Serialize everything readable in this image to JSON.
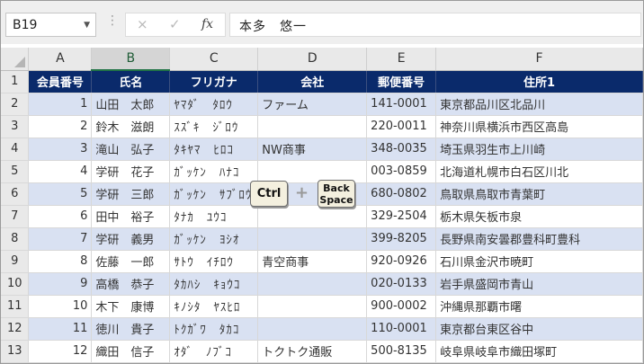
{
  "name_box": {
    "value": "B19"
  },
  "formula_bar": {
    "dots": "⋮",
    "cancel_icon": "×",
    "enter_icon": "✓",
    "fx_label": "fx",
    "content": "本多　悠一"
  },
  "columns": [
    "A",
    "B",
    "C",
    "D",
    "E",
    "F"
  ],
  "selected_column": "B",
  "header_row": {
    "row_number": "1",
    "cells": [
      "会員番号",
      "氏名",
      "フリガナ",
      "会社",
      "郵便番号",
      "住所1"
    ]
  },
  "rows": [
    {
      "row": "2",
      "id": "1",
      "name": "山田　太郎",
      "kana": "ﾔﾏﾀﾞ　ﾀﾛｳ",
      "company": "ファーム",
      "zip": "141-0001",
      "address": "東京都品川区北品川"
    },
    {
      "row": "3",
      "id": "2",
      "name": "鈴木　滋朗",
      "kana": "ｽｽﾞｷ　ｼﾞﾛｳ",
      "company": "",
      "zip": "220-0011",
      "address": "神奈川県横浜市西区高島"
    },
    {
      "row": "4",
      "id": "3",
      "name": "滝山　弘子",
      "kana": "ﾀｷﾔﾏ　ﾋﾛｺ",
      "company": "NW商事",
      "zip": "348-0035",
      "address": "埼玉県羽生市上川崎"
    },
    {
      "row": "5",
      "id": "4",
      "name": "学研　花子",
      "kana": "ｶﾞｯｹﾝ　ﾊﾅｺ",
      "company": "",
      "zip": "003-0859",
      "address": "北海道札幌市白石区川北"
    },
    {
      "row": "6",
      "id": "5",
      "name": "学研　三郎",
      "kana": "ｶﾞｯｹﾝ　ｻﾌﾞﾛｳ",
      "company": "",
      "zip": "680-0802",
      "address": "鳥取県鳥取市青葉町"
    },
    {
      "row": "7",
      "id": "6",
      "name": "田中　裕子",
      "kana": "ﾀﾅｶ　ﾕｳｺ",
      "company": "",
      "zip": "329-2504",
      "address": "栃木県矢板市泉"
    },
    {
      "row": "8",
      "id": "7",
      "name": "学研　義男",
      "kana": "ｶﾞｯｹﾝ　ﾖｼｵ",
      "company": "",
      "zip": "399-8205",
      "address": "長野県南安曇郡豊科町豊科"
    },
    {
      "row": "9",
      "id": "8",
      "name": "佐藤　一郎",
      "kana": "ｻﾄｳ　ｲﾁﾛｳ",
      "company": "青空商事",
      "zip": "920-0926",
      "address": "石川県金沢市暁町"
    },
    {
      "row": "10",
      "id": "9",
      "name": "高橋　恭子",
      "kana": "ﾀｶﾊｼ　ｷｮｳｺ",
      "company": "",
      "zip": "020-0133",
      "address": "岩手県盛岡市青山"
    },
    {
      "row": "11",
      "id": "10",
      "name": "木下　康博",
      "kana": "ｷﾉｼﾀ　ﾔｽﾋﾛ",
      "company": "",
      "zip": "900-0002",
      "address": "沖縄県那覇市曙"
    },
    {
      "row": "12",
      "id": "11",
      "name": "徳川　貴子",
      "kana": "ﾄｸｶﾞﾜ　ﾀｶｺ",
      "company": "",
      "zip": "110-0001",
      "address": "東京都台東区谷中"
    },
    {
      "row": "13",
      "id": "12",
      "name": "織田　信子",
      "kana": "ｵﾀﾞ　ﾉﾌﾞｺ",
      "company": "トクトク通販",
      "zip": "500-8135",
      "address": "岐阜県岐阜市織田塚町"
    }
  ],
  "keys": {
    "ctrl": "Ctrl",
    "plus": "+",
    "backspace_line1": "Back",
    "backspace_line2": "Space"
  },
  "colors": {
    "header_fill": "#0a2a6b",
    "band_fill": "#d9e1f2",
    "selection": "#217346"
  }
}
